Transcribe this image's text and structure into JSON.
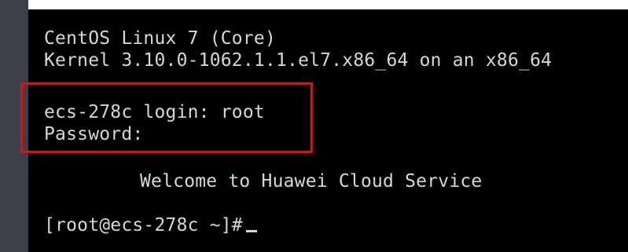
{
  "terminal": {
    "os_line": "CentOS Linux 7 (Core)",
    "kernel_line": "Kernel 3.10.0-1062.1.1.el7.x86_64 on an x86_64",
    "login_line": "ecs-278c login: root",
    "password_line": "Password:",
    "welcome_line": "Welcome to Huawei Cloud Service",
    "prompt_line": "[root@ecs-278c ~]#"
  },
  "colors": {
    "terminal_bg": "#000000",
    "terminal_text": "#d6d6d6",
    "highlight_border": "#e01010",
    "side_bar": "#3a3f4a"
  }
}
